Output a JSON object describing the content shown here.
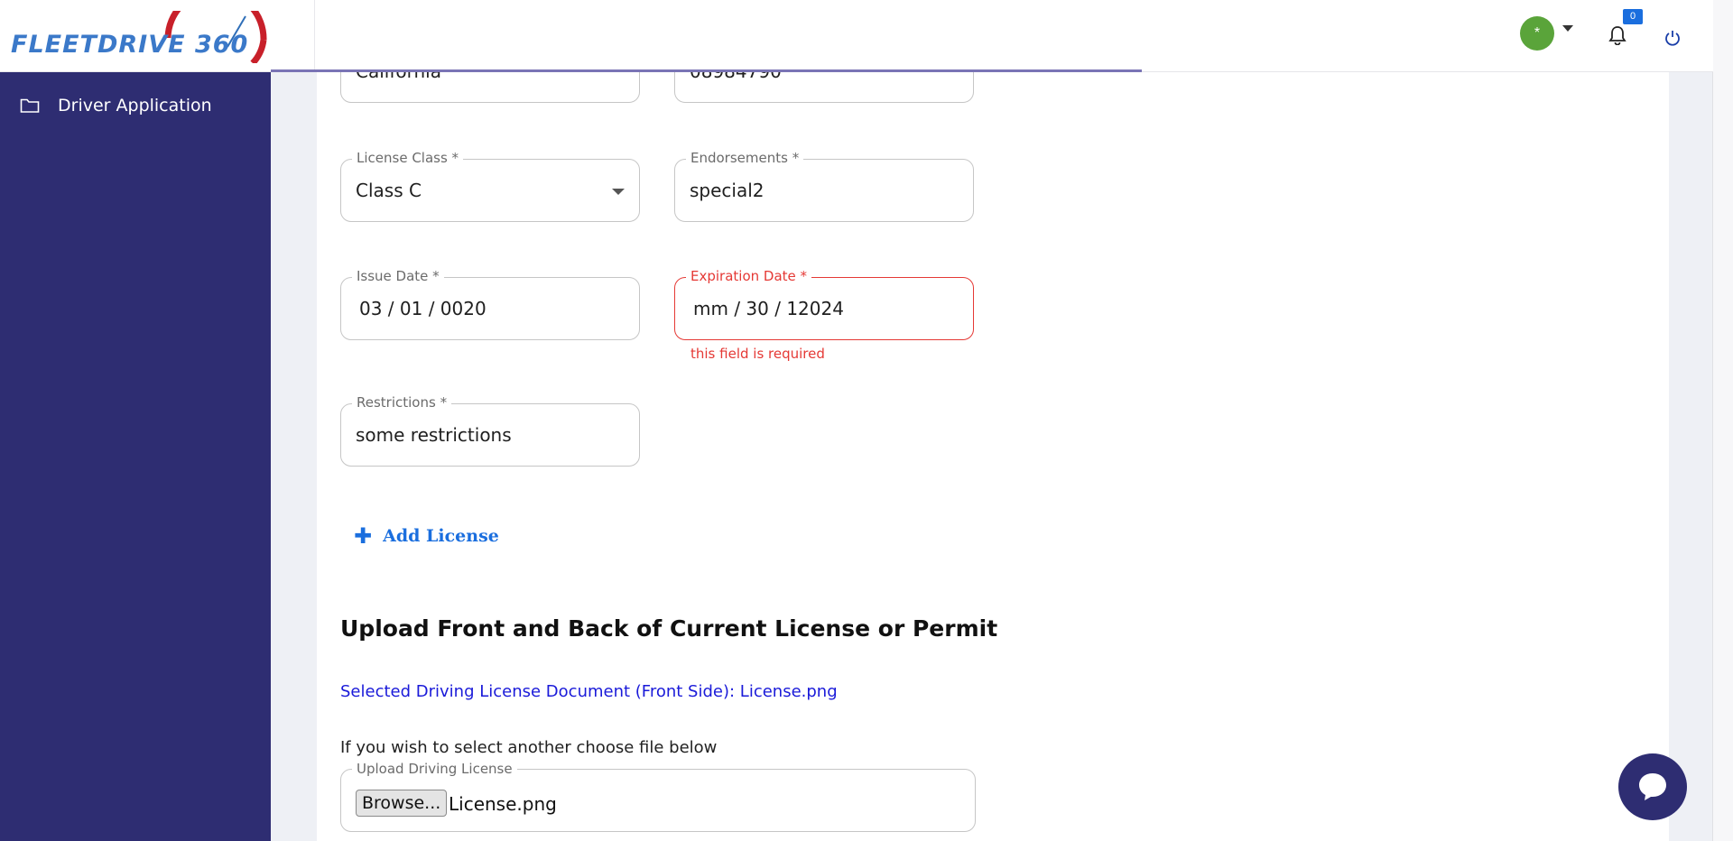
{
  "app": {
    "logo_text": "FLEETDRIVE 360",
    "notification_count": "0",
    "avatar_initial": "*"
  },
  "sidebar": {
    "items": [
      {
        "label": "Driver Application",
        "icon": "folder-icon"
      }
    ]
  },
  "form": {
    "partial_top_left": "California",
    "partial_top_right": "08984790",
    "license_class": {
      "label": "License Class *",
      "value": "Class C"
    },
    "endorsements": {
      "label": "Endorsements *",
      "value": "special2"
    },
    "issue_date": {
      "label": "Issue Date *",
      "value": "03 / 01 / 0020"
    },
    "expiration_date": {
      "label": "Expiration Date *",
      "value": "mm / 30 / 12024",
      "error": "this field is required"
    },
    "restrictions": {
      "label": "Restrictions *",
      "value": "some restrictions"
    },
    "add_license_label": "Add License"
  },
  "upload": {
    "section_title": "Upload Front and Back of Current License or Permit",
    "selected_doc": "Selected Driving License Document (Front Side):  License.png",
    "hint": "If you wish to select another choose file below",
    "field_label": "Upload Driving License",
    "browse_label": "Browse...",
    "file_name": "License.png"
  },
  "colors": {
    "sidebar": "#2e2d72",
    "accent": "#1a6ede",
    "error": "#e53935",
    "avatar": "#5aa43a"
  }
}
